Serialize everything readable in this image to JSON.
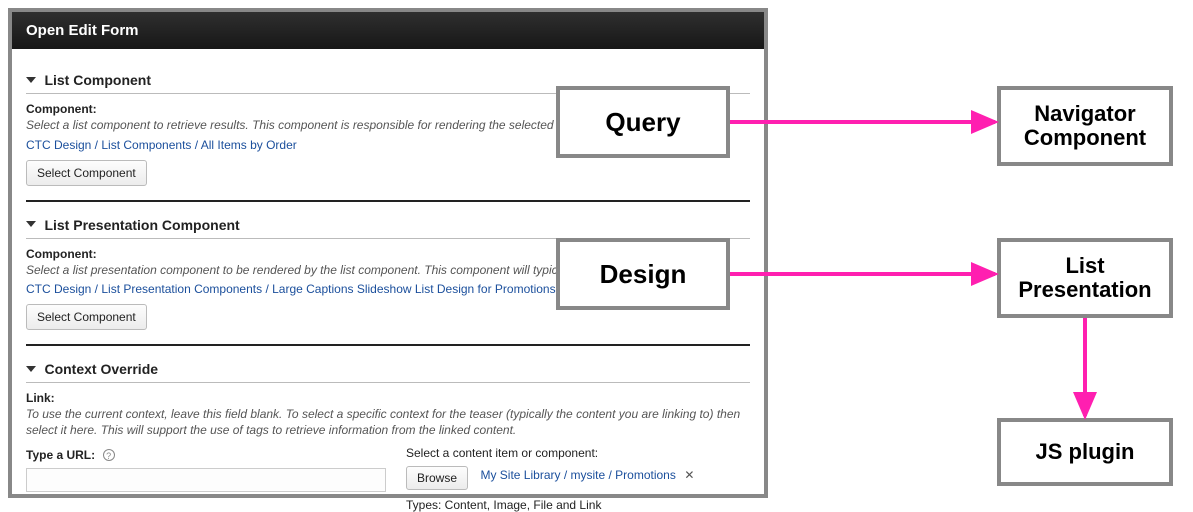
{
  "form": {
    "title": "Open Edit Form",
    "sections": {
      "listComponent": {
        "title": "List Component",
        "fieldLabel": "Component:",
        "desc": "Select a list component to retrieve results. This component is responsible for rendering the selected header, re",
        "path": "CTC Design / List Components / All Items by Order",
        "button": "Select Component"
      },
      "listPresentation": {
        "title": "List Presentation Component",
        "fieldLabel": "Component:",
        "desc": "Select a list presentation component to be rendered by the list component. This component will typically includ fields.",
        "path": "CTC Design / List Presentation Components / Large Captions Slideshow List Design for Promotions",
        "button": "Select Component"
      },
      "contextOverride": {
        "title": "Context Override",
        "fieldLabel": "Link:",
        "desc": "To use the current context, leave this field blank. To select a specific context for the teaser (typically the content you are linking to) then select it here. This will support the use of tags to retrieve information from the linked content.",
        "urlLabel": "Type a URL:",
        "urlValue": "",
        "selectLabel": "Select a content item or component:",
        "browseButton": "Browse",
        "browsePath": "My Site Library / mysite / Promotions",
        "typesLabel": "Types: Content, Image, File and Link"
      }
    }
  },
  "diagram": {
    "query": "Query",
    "design": "Design",
    "navigator": "Navigator Component",
    "listPresentation": "List Presentation",
    "jsPlugin": "JS plugin"
  }
}
